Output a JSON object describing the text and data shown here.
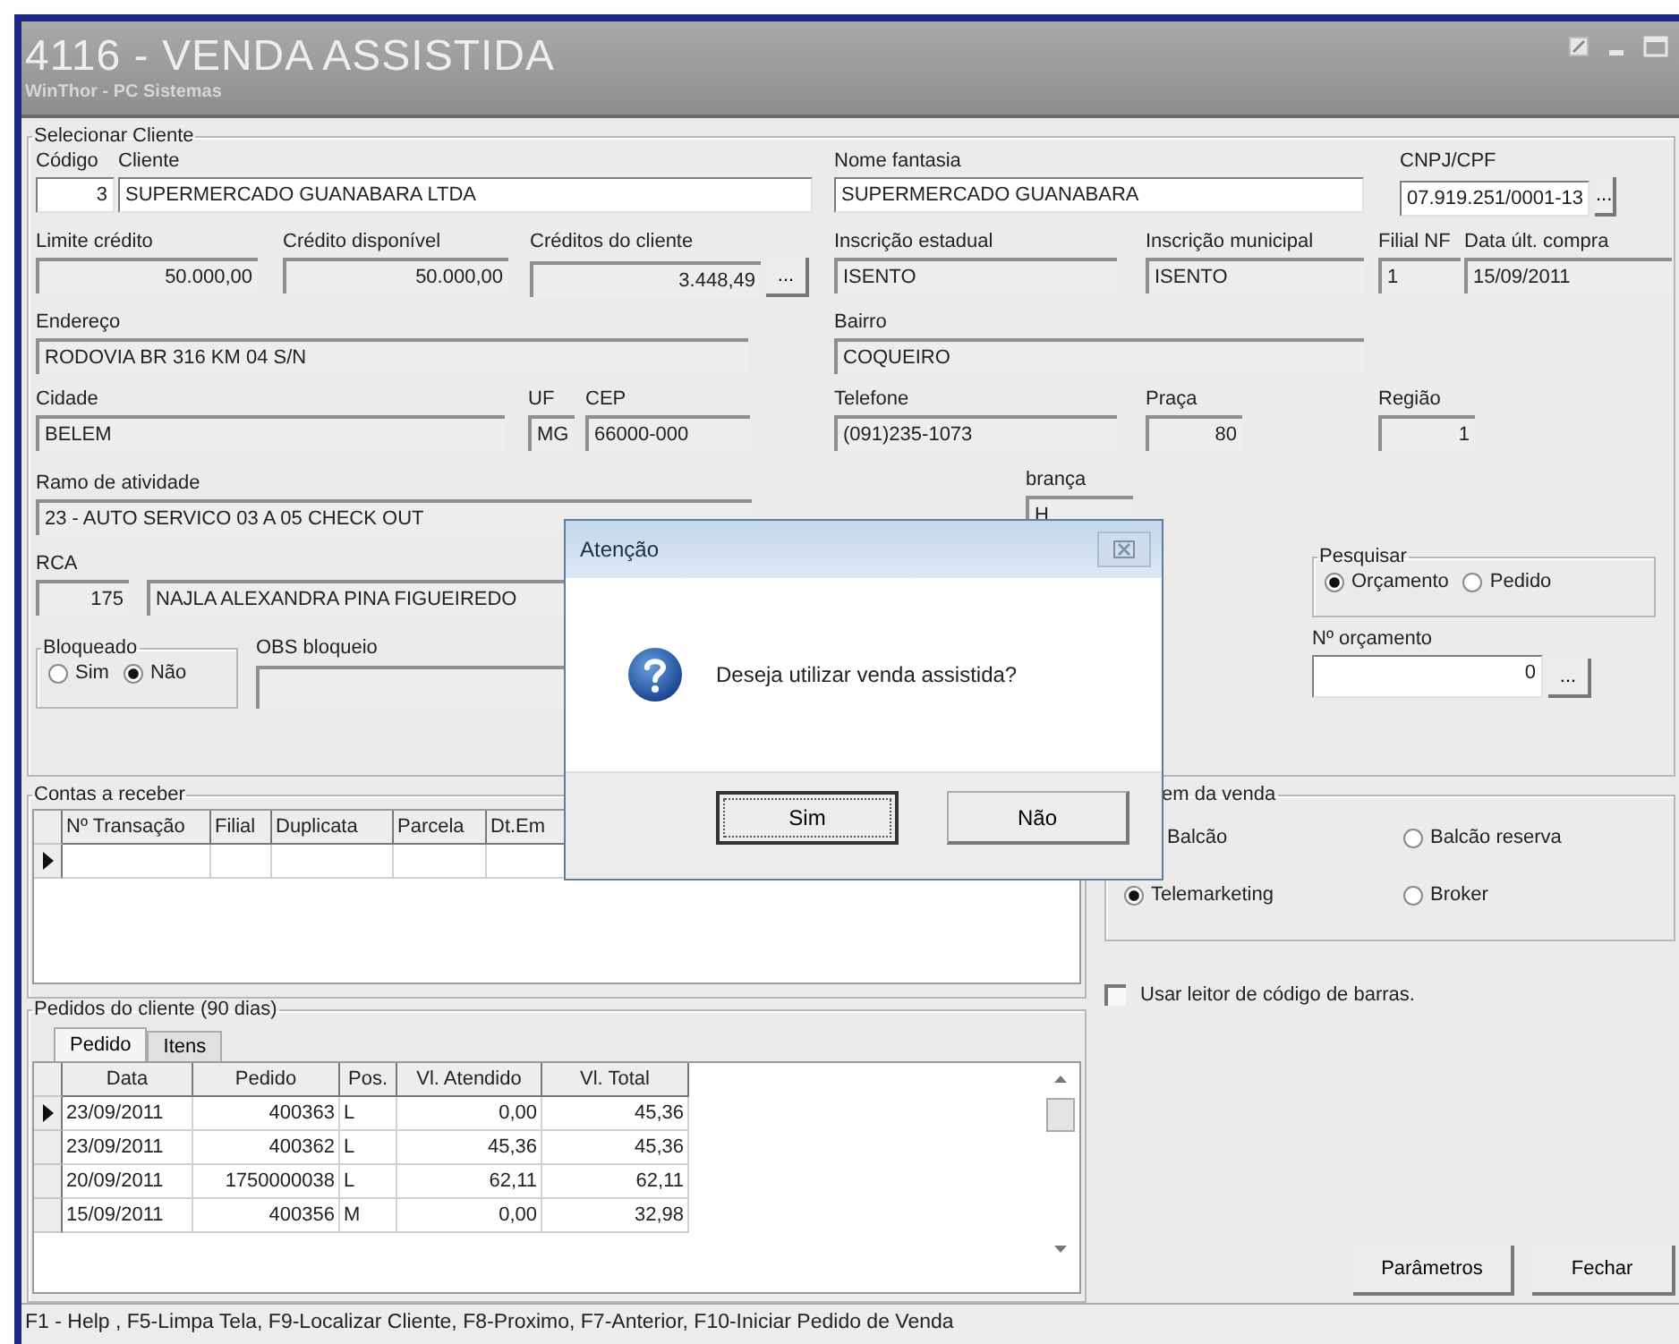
{
  "window": {
    "title": "4116 - VENDA ASSISTIDA",
    "subtitle": "WinThor - PC Sistemas"
  },
  "client": {
    "title": "Selecionar Cliente",
    "fields": [
      {
        "kind": "number",
        "label": "Código",
        "value": "3",
        "editable": true
      },
      {
        "kind": "text",
        "label": "Cliente",
        "value": "SUPERMERCADO GUANABARA LTDA",
        "editable": true
      },
      {
        "kind": "text",
        "label": "Nome fantasia",
        "value": "SUPERMERCADO GUANABARA",
        "editable": true
      },
      {
        "kind": "text",
        "label": "CNPJ/CPF",
        "value": "07.919.251/0001-13",
        "editable": true,
        "button": "..."
      },
      {
        "kind": "number",
        "label": "Limite crédito",
        "value": "50.000,00",
        "editable": false
      },
      {
        "kind": "number",
        "label": "Crédito disponível",
        "value": "50.000,00",
        "editable": false
      },
      {
        "kind": "number",
        "label": "Créditos do cliente",
        "value": "3.448,49",
        "editable": false,
        "button": "..."
      },
      {
        "kind": "text",
        "label": "Inscrição estadual",
        "value": "ISENTO",
        "editable": false
      },
      {
        "kind": "text",
        "label": "Inscrição municipal",
        "value": "ISENTO",
        "editable": false
      },
      {
        "kind": "text",
        "label": "Filial NF",
        "value": "1",
        "editable": false
      },
      {
        "kind": "text",
        "label": "Data últ. compra",
        "value": "15/09/2011",
        "editable": false
      },
      {
        "kind": "text",
        "label": "Endereço",
        "value": "RODOVIA BR 316 KM 04  S/N",
        "editable": false
      },
      {
        "kind": "text",
        "label": "Bairro",
        "value": "COQUEIRO",
        "editable": false
      },
      {
        "kind": "text",
        "label": "Cidade",
        "value": "BELEM",
        "editable": false
      },
      {
        "kind": "text",
        "label": "UF",
        "value": "MG",
        "editable": false
      },
      {
        "kind": "text",
        "label": "CEP",
        "value": "66000-000",
        "editable": false
      },
      {
        "kind": "text",
        "label": "Telefone",
        "value": "(091)235-1073",
        "editable": false
      },
      {
        "kind": "number",
        "label": "Praça",
        "value": "80",
        "editable": false
      },
      {
        "kind": "number",
        "label": "Região",
        "value": "1",
        "editable": false
      }
    ],
    "activity": {
      "label": "Ramo de atividade",
      "value": "23 - AUTO SERVICO 03 A 05 CHECK OUT"
    },
    "rca": {
      "label": "RCA",
      "code": "175",
      "name": "NAJLA ALEXANDRA PINA FIGUEIREDO"
    },
    "blocked": {
      "title": "Bloqueado",
      "options": [
        {
          "label": "Sim",
          "selected": false
        },
        {
          "label": "Não",
          "selected": true
        }
      ]
    },
    "block_note": {
      "label": "OBS bloqueio"
    },
    "billing": {
      "label": "brança",
      "value": "H"
    },
    "search": {
      "title": "Pesquisar",
      "options": [
        {
          "label": "Orçamento",
          "selected": true
        },
        {
          "label": "Pedido",
          "selected": false
        }
      ]
    },
    "quote_number": {
      "label": "Nº orçamento",
      "value": "0",
      "button": "..."
    }
  },
  "receivables": {
    "title": "Contas a receber",
    "columns": [
      "Nº Transação",
      "Filial",
      "Duplicata",
      "Parcela",
      "Dt.Em"
    ]
  },
  "origin": {
    "title": "em da venda",
    "options": [
      {
        "kind": "text",
        "label": "Balcão"
      },
      {
        "kind": "radio",
        "label": "Balcão reserva",
        "selected": false
      },
      {
        "kind": "radio",
        "label": "Telemarketing",
        "selected": true
      },
      {
        "kind": "radio",
        "label": "Broker",
        "selected": false
      }
    ]
  },
  "barcode": {
    "label": "Usar leitor de código de barras.",
    "checked": false
  },
  "orders": {
    "title": "Pedidos do cliente (90 dias)",
    "tabs": [
      {
        "label": "Pedido",
        "selected": true
      },
      {
        "label": "Itens",
        "selected": false
      }
    ],
    "columns": [
      "Data",
      "Pedido",
      "Pos.",
      "Vl. Atendido",
      "Vl. Total"
    ],
    "rows": [
      {
        "current": true,
        "cells": [
          "23/09/2011",
          "400363",
          "L",
          "0,00",
          "45,36"
        ]
      },
      {
        "current": false,
        "cells": [
          "23/09/2011",
          "400362",
          "L",
          "45,36",
          "45,36"
        ]
      },
      {
        "current": false,
        "cells": [
          "20/09/2011",
          "1750000038",
          "L",
          "62,11",
          "62,11"
        ]
      },
      {
        "current": false,
        "cells": [
          "15/09/2011",
          "400356",
          "M",
          "0,00",
          "32,98"
        ]
      }
    ]
  },
  "buttons": [
    "Parâmetros",
    "Fechar"
  ],
  "dialog": {
    "title": "Atenção",
    "message": "Deseja utilizar venda assistida?",
    "buttons": [
      {
        "label": "Sim",
        "default": true
      },
      {
        "label": "Não",
        "default": false
      }
    ]
  },
  "status_bar": "F1 - Help , F5-Limpa Tela, F9-Localizar Cliente, F8-Proximo, F7-Anterior, F10-Iniciar Pedido de Venda"
}
